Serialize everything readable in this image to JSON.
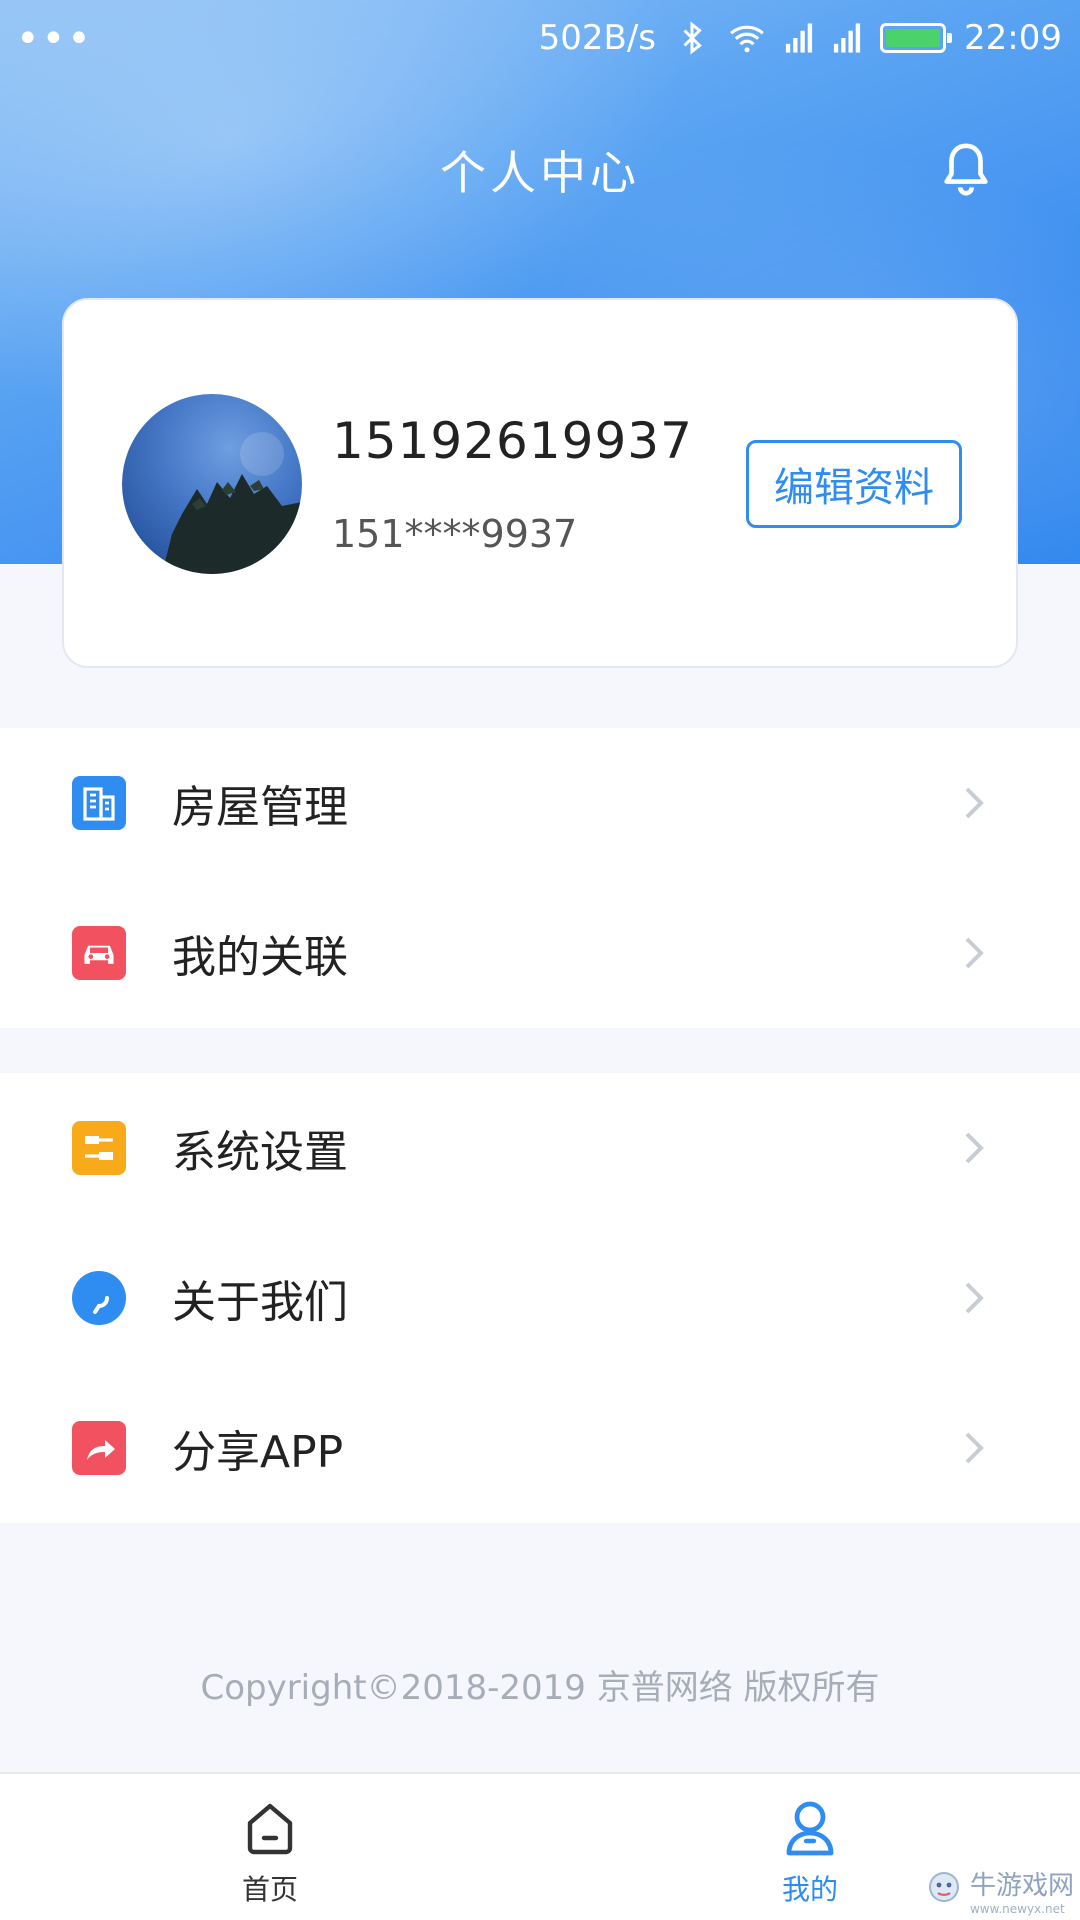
{
  "status_bar": {
    "net_speed": "502B/s",
    "time": "22:09",
    "more_icon": "dots-icon",
    "icons": [
      "bluetooth-icon",
      "wifi-icon",
      "signal-icon",
      "signal-icon",
      "battery-icon"
    ]
  },
  "header": {
    "title": "个人中心",
    "bell_icon": "bell-icon"
  },
  "profile": {
    "phone": "15192619937",
    "masked_phone": "151****9937",
    "edit_label": "编辑资料"
  },
  "menu": {
    "group1": [
      {
        "label": "房屋管理",
        "icon": "building-icon",
        "color": "#2f8cf0"
      },
      {
        "label": "我的关联",
        "icon": "car-icon",
        "color": "#f2525f"
      }
    ],
    "group2": [
      {
        "label": "系统设置",
        "icon": "settings-icon",
        "color": "#f8aa1b"
      },
      {
        "label": "关于我们",
        "icon": "chat-bubble-icon",
        "color": "#2f8cf0"
      },
      {
        "label": "分享APP",
        "icon": "share-icon",
        "color": "#f2525f"
      }
    ]
  },
  "footer": {
    "copyright": "Copyright©2018-2019 京普网络 版权所有"
  },
  "tabbar": {
    "home_label": "首页",
    "mine_label": "我的",
    "active": "我的"
  },
  "watermark": {
    "text": "牛游戏网",
    "sub": "www.newyx.net"
  },
  "colors": {
    "accent": "#2f8cf0",
    "hero_start": "#93c4f6",
    "hero_end": "#2f86ee",
    "red": "#f2525f",
    "orange": "#f8aa1b",
    "background": "#f5f7fc"
  }
}
